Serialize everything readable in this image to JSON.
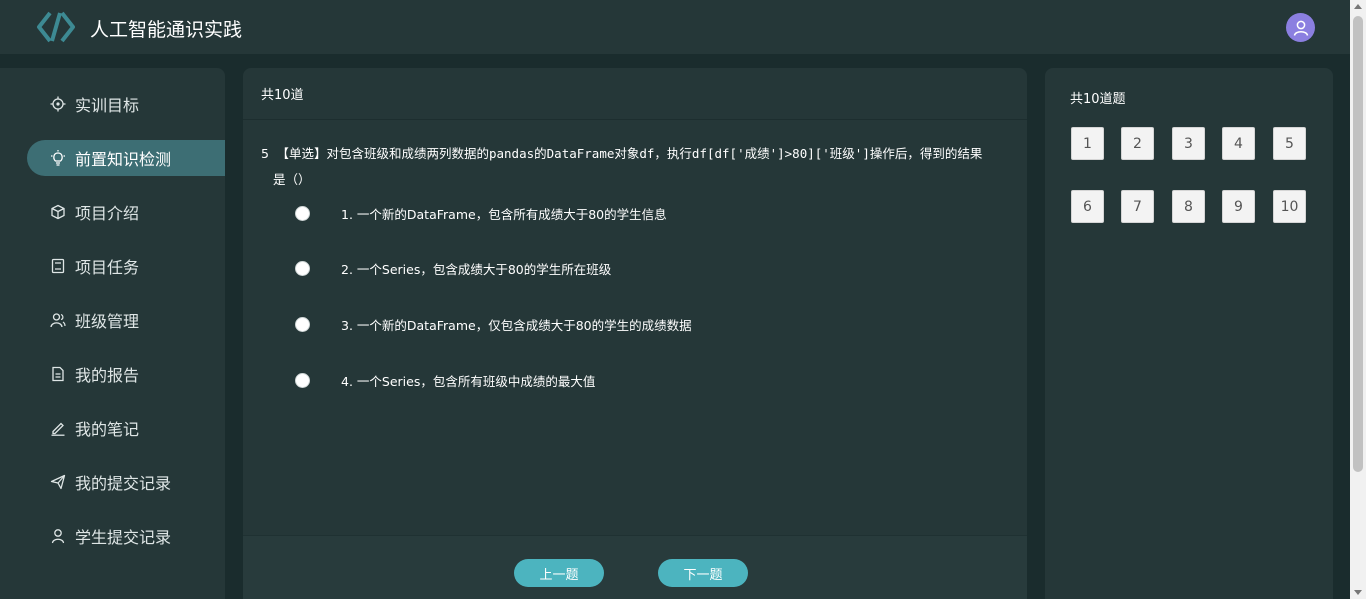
{
  "app": {
    "title": "人工智能通识实践",
    "logo_icon": "bracket-logo-icon",
    "avatar_icon": "user-avatar-icon",
    "accent": "#4cb4bf",
    "active_nav_bg": "#3d6e74"
  },
  "sidebar": {
    "items": [
      {
        "label": "实训目标",
        "icon": "target-icon"
      },
      {
        "label": "前置知识检测",
        "icon": "lightbulb-icon",
        "active": true
      },
      {
        "label": "项目介绍",
        "icon": "cube-icon"
      },
      {
        "label": "项目任务",
        "icon": "clipboard-icon"
      },
      {
        "label": "班级管理",
        "icon": "users-icon"
      },
      {
        "label": "我的报告",
        "icon": "document-icon"
      },
      {
        "label": "我的笔记",
        "icon": "pencil-icon"
      },
      {
        "label": "我的提交记录",
        "icon": "send-icon"
      },
      {
        "label": "学生提交记录",
        "icon": "student-icon"
      }
    ]
  },
  "main": {
    "header": "共10道",
    "question": {
      "number": "5",
      "line1": "【单选】对包含班级和成绩两列数据的pandas的DataFrame对象df，执行df[df['成绩']>80]['班级']操作后，得到的结果",
      "line2": "是（）"
    },
    "options": [
      "1. 一个新的DataFrame，包含所有成绩大于80的学生信息",
      "2. 一个Series，包含成绩大于80的学生所在班级",
      "3. 一个新的DataFrame，仅包含成绩大于80的学生的成绩数据",
      "4. 一个Series，包含所有班级中成绩的最大值"
    ],
    "prev_label": "上一题",
    "next_label": "下一题"
  },
  "right": {
    "title": "共10道题",
    "numbers": [
      "1",
      "2",
      "3",
      "4",
      "5",
      "6",
      "7",
      "8",
      "9",
      "10"
    ]
  }
}
